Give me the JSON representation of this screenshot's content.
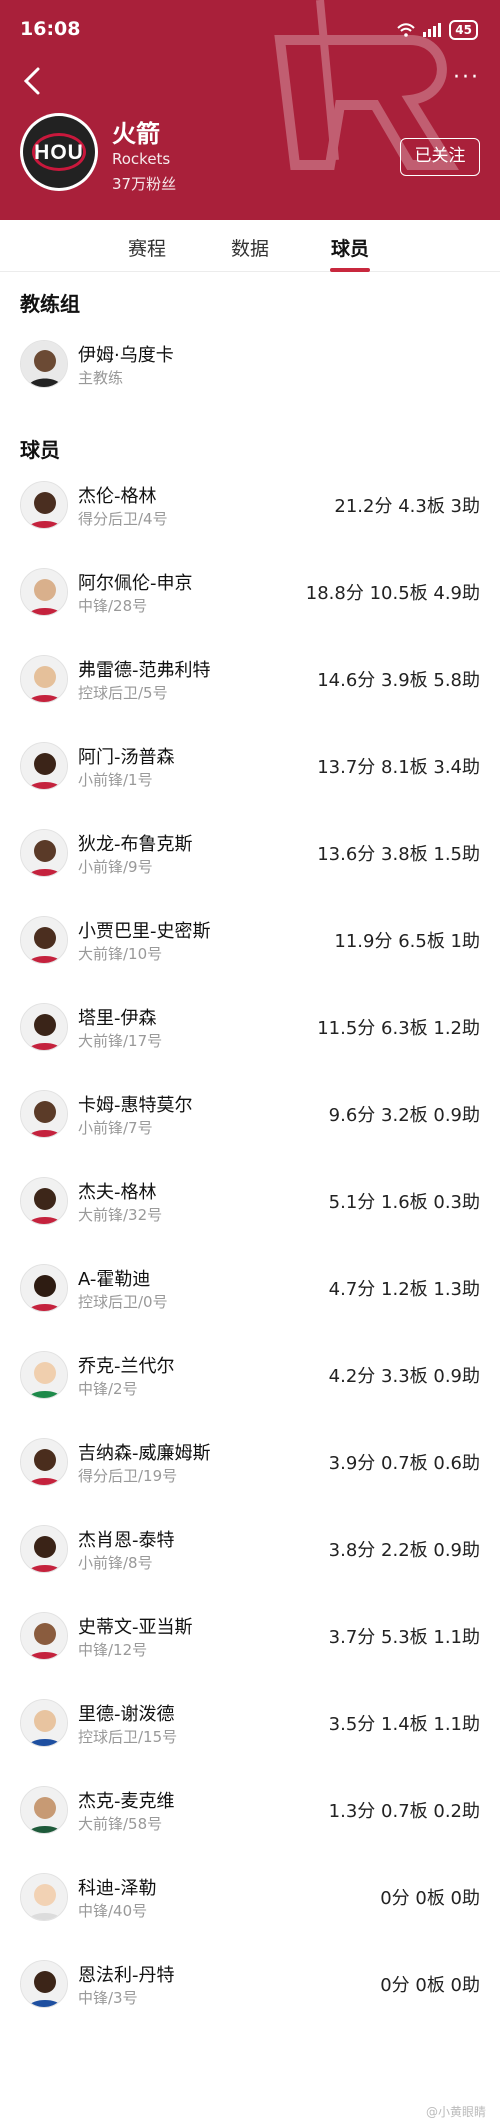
{
  "status": {
    "time": "16:08",
    "battery": "45"
  },
  "team": {
    "abbr": "HOU",
    "name": "火箭",
    "english": "Rockets",
    "fans": "37万粉丝",
    "follow_label": "已关注"
  },
  "tabs": [
    {
      "label": "赛程",
      "active": false
    },
    {
      "label": "数据",
      "active": false
    },
    {
      "label": "球员",
      "active": true
    }
  ],
  "coach_section": {
    "title": "教练组",
    "coach": {
      "name": "伊姆·乌度卡",
      "role": "主教练"
    }
  },
  "players_section": {
    "title": "球员",
    "players": [
      {
        "name": "杰伦-格林",
        "position": "得分后卫/4号",
        "stats": "21.2分 4.3板 3助"
      },
      {
        "name": "阿尔佩伦-申京",
        "position": "中锋/28号",
        "stats": "18.8分 10.5板 4.9助"
      },
      {
        "name": "弗雷德-范弗利特",
        "position": "控球后卫/5号",
        "stats": "14.6分 3.9板 5.8助"
      },
      {
        "name": "阿门-汤普森",
        "position": "小前锋/1号",
        "stats": "13.7分 8.1板 3.4助"
      },
      {
        "name": "狄龙-布鲁克斯",
        "position": "小前锋/9号",
        "stats": "13.6分 3.8板 1.5助"
      },
      {
        "name": "小贾巴里-史密斯",
        "position": "大前锋/10号",
        "stats": "11.9分 6.5板 1助"
      },
      {
        "name": "塔里-伊森",
        "position": "大前锋/17号",
        "stats": "11.5分 6.3板 1.2助"
      },
      {
        "name": "卡姆-惠特莫尔",
        "position": "小前锋/7号",
        "stats": "9.6分 3.2板 0.9助"
      },
      {
        "name": "杰夫-格林",
        "position": "大前锋/32号",
        "stats": "5.1分 1.6板 0.3助"
      },
      {
        "name": "A-霍勒迪",
        "position": "控球后卫/0号",
        "stats": "4.7分 1.2板 1.3助"
      },
      {
        "name": "乔克-兰代尔",
        "position": "中锋/2号",
        "stats": "4.2分 3.3板 0.9助"
      },
      {
        "name": "吉纳森-威廉姆斯",
        "position": "得分后卫/19号",
        "stats": "3.9分 0.7板 0.6助"
      },
      {
        "name": "杰肖恩-泰特",
        "position": "小前锋/8号",
        "stats": "3.8分 2.2板 0.9助"
      },
      {
        "name": "史蒂文-亚当斯",
        "position": "中锋/12号",
        "stats": "3.7分 5.3板 1.1助"
      },
      {
        "name": "里德-谢泼德",
        "position": "控球后卫/15号",
        "stats": "3.5分 1.4板 1.1助"
      },
      {
        "name": "杰克-麦克维",
        "position": "大前锋/58号",
        "stats": "1.3分 0.7板 0.2助"
      },
      {
        "name": "科迪-泽勒",
        "position": "中锋/40号",
        "stats": "0分 0板 0助"
      },
      {
        "name": "恩法利-丹特",
        "position": "中锋/3号",
        "stats": "0分 0板 0助"
      }
    ]
  },
  "watermark": "@小黄眼睛",
  "colors": {
    "header": "#a9203a",
    "accent": "#c8283e"
  }
}
